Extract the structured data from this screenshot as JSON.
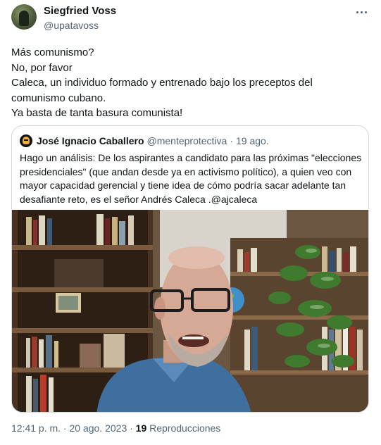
{
  "author": {
    "name": "Siegfried Voss",
    "handle": "@upatavoss"
  },
  "tweet_lines": [
    "Más comunismo?",
    "No, por favor",
    "Caleca, un individuo formado y entrenado bajo los preceptos del",
    "comunismo cubano.",
    "Ya basta de tanta basura comunista!"
  ],
  "quote": {
    "name": "José Ignacio Caballero",
    "handle": "@menteprotectiva",
    "separator": "·",
    "date": "19 ago.",
    "lines": [
      "Hago un análisis: De los aspirantes a candidato para las próximas \"elecciones",
      "presidenciales\" (que andan desde ya en activismo político), a quien veo con",
      "mayor capacidad gerencial y tiene idea de cómo podría sacar adelante tan",
      "desafiante reto, es el señor Andrés Caleca .@ajcaleca"
    ]
  },
  "meta": {
    "time_date": "12:41 p. m. · 20 ago. 2023 · ",
    "views_count": "19",
    "views_label": " Reproducciones"
  },
  "colors": {
    "text": "#0f1419",
    "secondary": "#536471",
    "border": "#cfd9de"
  },
  "icons": {
    "more": "more-icon"
  }
}
